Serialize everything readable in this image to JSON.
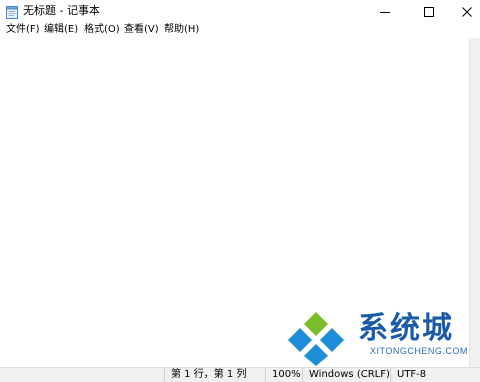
{
  "window": {
    "title": "无标题 - 记事本"
  },
  "menu": {
    "items": [
      {
        "label": "文件(F)"
      },
      {
        "label": "编辑(E)"
      },
      {
        "label": "格式(O)"
      },
      {
        "label": "查看(V)"
      },
      {
        "label": "帮助(H)"
      }
    ]
  },
  "editor": {
    "content": ""
  },
  "status": {
    "position": "第 1 行，第 1 列",
    "zoom": "100%",
    "line_ending": "Windows (CRLF)",
    "encoding": "UTF-8"
  },
  "watermark": {
    "text": "系统城",
    "sub": "XITONGCHENG.COM"
  },
  "colors": {
    "logo_green": "#7cbd2a",
    "logo_blue": "#1e8ed8",
    "watermark_text": "#1a5aa8"
  },
  "icons": {
    "app": "notepad-icon",
    "minimize": "minimize-icon",
    "maximize": "maximize-icon",
    "close": "close-icon"
  }
}
